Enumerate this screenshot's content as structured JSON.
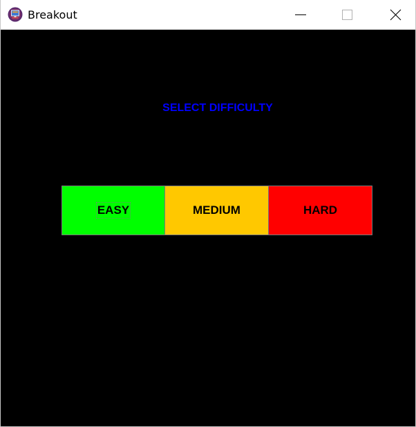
{
  "window": {
    "title": "Breakout",
    "icon": "breakout-app-icon",
    "controls": {
      "minimize_icon": "minimize-icon",
      "maximize_icon": "maximize-icon",
      "close_icon": "close-icon"
    }
  },
  "game": {
    "background": "#000000",
    "heading": "SELECT DIFFICULTY",
    "heading_color": "#0000ff",
    "difficulties": [
      {
        "label": "EASY",
        "color": "#00ff00",
        "focused": true
      },
      {
        "label": "MEDIUM",
        "color": "#ffc800",
        "focused": false
      },
      {
        "label": "HARD",
        "color": "#ff0000",
        "focused": false
      }
    ]
  }
}
